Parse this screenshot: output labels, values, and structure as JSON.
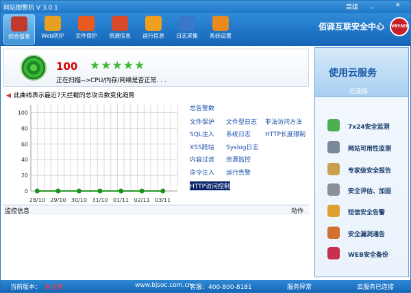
{
  "window": {
    "title": "网站御警机 V 3.0.1",
    "advanced": "高级",
    "min": "_",
    "close": "✕"
  },
  "toolbar": {
    "items": [
      {
        "label": "综合信息",
        "color": "#c0392b"
      },
      {
        "label": "Web防护",
        "color": "#e8a020"
      },
      {
        "label": "文件保护",
        "color": "#e85a20"
      },
      {
        "label": "资源信息",
        "color": "#d84b2a"
      },
      {
        "label": "运行信息",
        "color": "#f0a020"
      },
      {
        "label": "日志采集",
        "color": "#3a78c8"
      },
      {
        "label": "系统设置",
        "color": "#e88a20"
      }
    ],
    "brand": "佰驿互联安全中心",
    "logo": "VBYSEE"
  },
  "status": {
    "score": "100",
    "stars": "★★★★★",
    "scan_text": "正在扫描-->CPU/内存/网络是否正常. . ."
  },
  "notice": {
    "icon": "speaker-icon",
    "text": "此曲线表示最近7天拦截的总攻击数变化趋势"
  },
  "chart_data": {
    "type": "line",
    "categories": [
      "28/10",
      "29/10",
      "30/10",
      "31/10",
      "01/11",
      "02/11",
      "03/11"
    ],
    "series": [
      {
        "values": [
          0,
          0,
          0,
          0,
          0,
          0,
          0
        ]
      }
    ],
    "ylim": [
      0,
      110
    ],
    "yticks": [
      "0",
      "20",
      "40",
      "60",
      "80",
      "100"
    ],
    "grid": true
  },
  "legend": [
    "总告警数",
    "文件保护",
    "文件型日志",
    "非法访问方法",
    "SQL注入",
    "系统日志",
    "HTTP长度限制",
    "XSS跨站",
    "Syslog日志",
    "内容过滤",
    "资源监控",
    "命令注入",
    "运行告警",
    "HTTP访问控制"
  ],
  "monitor": {
    "title": "监控信息",
    "action": "动作"
  },
  "side": {
    "cloud_title": "使用云服务",
    "cloud_status": "已连接",
    "items": [
      {
        "label": "7x24安全监测",
        "color": "#4caf50"
      },
      {
        "label": "网站可用性监测",
        "color": "#7a8a9a"
      },
      {
        "label": "专家级安全报告",
        "color": "#c8a050"
      },
      {
        "label": "安全评估、加固",
        "color": "#8a9098"
      },
      {
        "label": "短信安全告警",
        "color": "#e0a030"
      },
      {
        "label": "安全漏洞通告",
        "color": "#d07030"
      },
      {
        "label": "WEB安全备份",
        "color": "#c83050"
      }
    ]
  },
  "statusbar": {
    "version_label": "当前版本：",
    "version_value": "未注册",
    "site": "www.bjsoc.com.cn",
    "hotline": "客服：400-800-8181",
    "service": "服务异常",
    "cloud": "云服务已连接"
  }
}
